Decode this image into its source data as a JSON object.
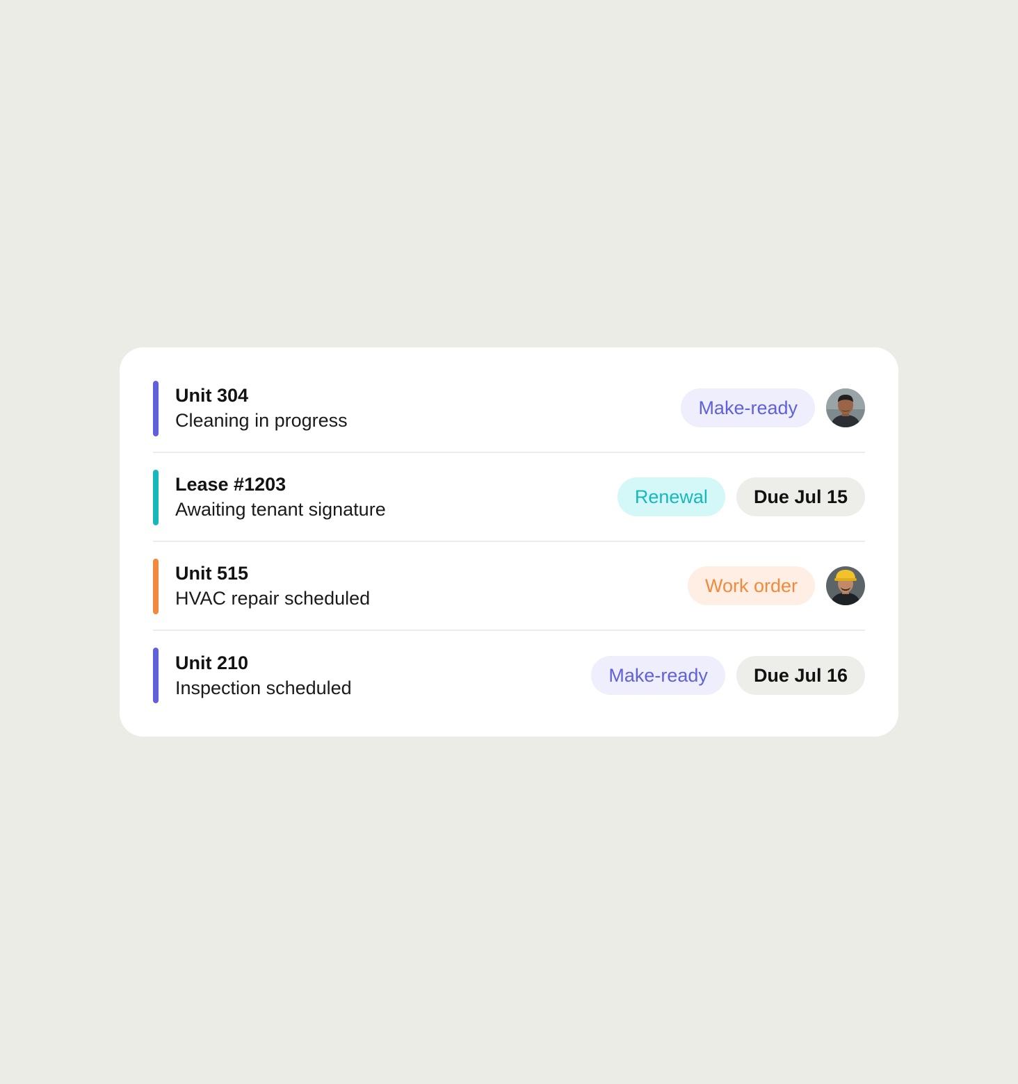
{
  "colors": {
    "background": "#ECECE7",
    "card": "#FFFFFF",
    "accent_purple": "#6160DB",
    "accent_teal": "#17B8BD",
    "accent_orange": "#F08A3E"
  },
  "tasks": [
    {
      "title": "Unit 304",
      "subtitle": "Cleaning in progress",
      "accent": "#6160DB",
      "tag": "Make-ready",
      "avatar_icon": "worker-avatar"
    },
    {
      "title": "Lease #1203",
      "subtitle": "Awaiting tenant signature",
      "accent": "#17B8BD",
      "tag": "Renewal",
      "due": "Due Jul 15"
    },
    {
      "title": "Unit 515",
      "subtitle": "HVAC repair scheduled",
      "accent": "#F08A3E",
      "tag": "Work order",
      "avatar_icon": "hardhat-worker-avatar"
    },
    {
      "title": "Unit 210",
      "subtitle": "Inspection scheduled",
      "accent": "#6160DB",
      "tag": "Make-ready",
      "due": "Due Jul 16"
    }
  ]
}
